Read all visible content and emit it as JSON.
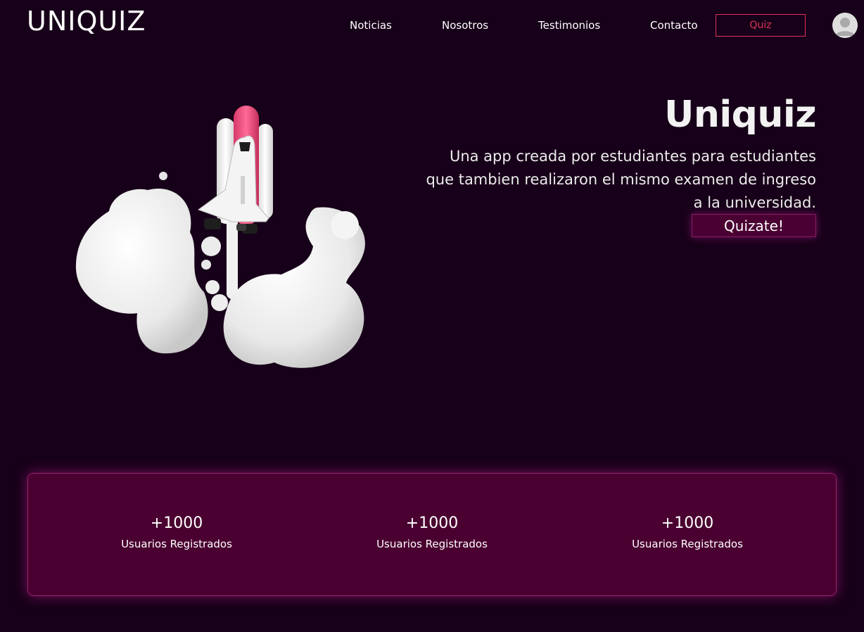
{
  "header": {
    "logo": "UNIQUIZ",
    "nav": [
      "Noticias",
      "Nosotros",
      "Testimonios",
      "Contacto"
    ],
    "quiz_button": "Quiz",
    "accent_color": "#e0335a"
  },
  "hero": {
    "title": "Uniquiz",
    "description_lines": [
      "Una app creada por estudiantes para estudiantes",
      "que tambien realizaron el mismo examen de ingreso",
      "a la universidad."
    ],
    "cta_label": "Quizate!",
    "illustration": "rocket-launch-illustration"
  },
  "stats": [
    {
      "value": "+1000",
      "label": "Usuarios Registrados"
    },
    {
      "value": "+1000",
      "label": "Usuarios Registrados"
    },
    {
      "value": "+1000",
      "label": "Usuarios Registrados"
    }
  ],
  "colors": {
    "background": "#170019",
    "panel": "#4a0030",
    "glow": "#c81e96"
  }
}
